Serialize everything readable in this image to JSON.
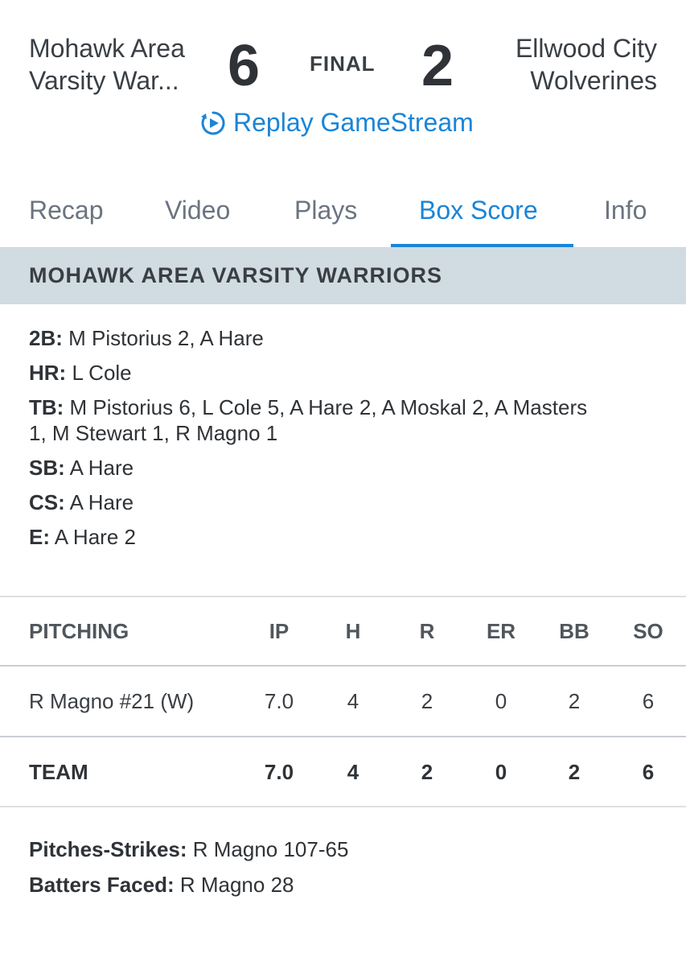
{
  "game": {
    "away_team_line1": "Mohawk Area",
    "away_team_line2": "Varsity War...",
    "away_score": "6",
    "status": "FINAL",
    "home_score": "2",
    "home_team_line1": "Ellwood City",
    "home_team_line2": "Wolverines",
    "replay_label": "Replay GameStream"
  },
  "tabs": [
    {
      "label": "Recap"
    },
    {
      "label": "Video"
    },
    {
      "label": "Plays"
    },
    {
      "label": "Box Score",
      "active": true
    },
    {
      "label": "Info"
    }
  ],
  "section": {
    "title": "MOHAWK AREA VARSITY WARRIORS"
  },
  "batting_notes": [
    {
      "key": "2B:",
      "value": " M Pistorius 2, A Hare"
    },
    {
      "key": "HR:",
      "value": " L Cole"
    },
    {
      "key": "TB:",
      "value": " M Pistorius 6, L Cole 5, A Hare 2, A Moskal 2, A Masters 1, M Stewart 1, R Magno 1"
    },
    {
      "key": "SB:",
      "value": " A Hare"
    },
    {
      "key": "CS:",
      "value": " A Hare"
    },
    {
      "key": "E:",
      "value": " A Hare 2"
    }
  ],
  "pitching": {
    "headers": [
      "PITCHING",
      "IP",
      "H",
      "R",
      "ER",
      "BB",
      "SO"
    ],
    "rows": [
      [
        "R Magno #21 (W)",
        "7.0",
        "4",
        "2",
        "0",
        "2",
        "6"
      ]
    ],
    "team_row": [
      "TEAM",
      "7.0",
      "4",
      "2",
      "0",
      "2",
      "6"
    ]
  },
  "pitching_notes": [
    {
      "key": "Pitches-Strikes:",
      "value": " R Magno 107-65"
    },
    {
      "key": "Batters Faced:",
      "value": " R Magno 28"
    }
  ],
  "colors": {
    "accent": "#1a85d6",
    "section_bg": "#d1dbe2"
  }
}
